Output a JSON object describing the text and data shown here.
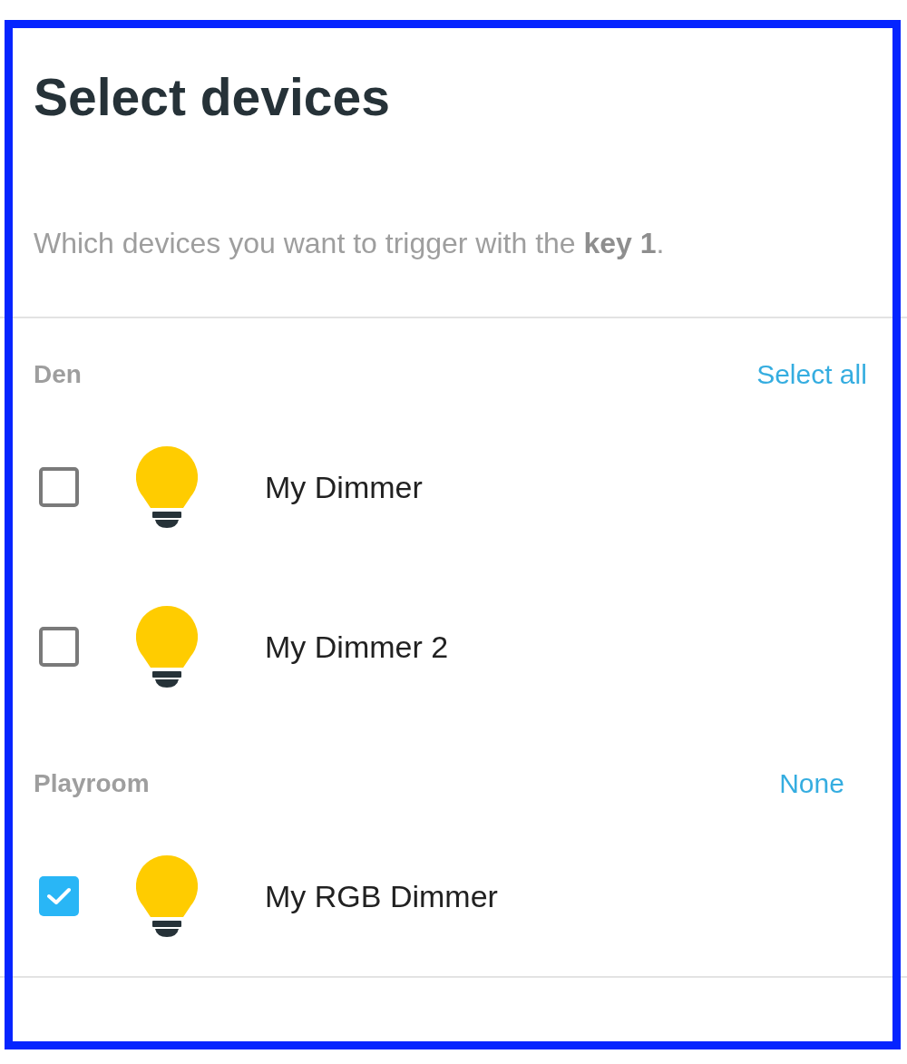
{
  "dialog": {
    "title": "Select devices",
    "description": "Which devices you want to trigger with the **key 1**."
  },
  "groups": [
    {
      "name": "Den",
      "action": "Select all",
      "devices": [
        {
          "name": "My Dimmer",
          "checked": false
        },
        {
          "name": "My Dimmer 2",
          "checked": false
        }
      ]
    },
    {
      "name": "Playroom",
      "action": "None",
      "devices": [
        {
          "name": "My RGB Dimmer",
          "checked": true
        }
      ]
    }
  ]
}
